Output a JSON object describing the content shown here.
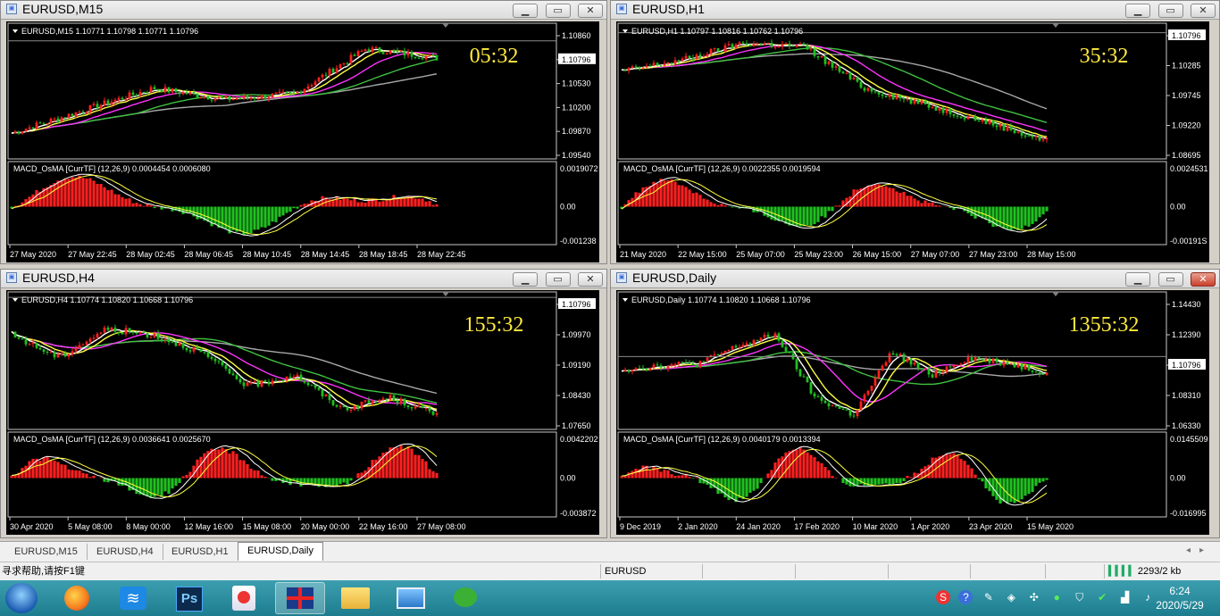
{
  "windows": [
    {
      "id": "m15",
      "title": "EURUSD,M15",
      "header": "EURUSD,M15  1.10771 1.10798 1.10771 1.10796",
      "countdown": "05:32",
      "price_scale": [
        "1.10860",
        "1.10796",
        "1.10530",
        "1.10200",
        "1.09870",
        "1.09540"
      ],
      "price_level": 0.87,
      "indicator_header": "MACD_OsMA [CurrTF] (12,26,9) 0.0004454 0.0006080",
      "indicator_scale": [
        "0.0019072",
        "0.00",
        "-0.001238"
      ],
      "time_labels": [
        "27 May 2020",
        "27 May 22:45",
        "28 May 02:45",
        "28 May 06:45",
        "28 May 10:45",
        "28 May 14:45",
        "28 May 18:45",
        "28 May 22:45"
      ],
      "close_red": false
    },
    {
      "id": "h1",
      "title": "EURUSD,H1",
      "header": "EURUSD,H1  1.10797 1.10816 1.10762 1.10796",
      "countdown": "35:32",
      "price_scale": [
        "1.10796",
        "1.10285",
        "1.09745",
        "1.09220",
        "1.08695"
      ],
      "price_level": 0.93,
      "indicator_header": "MACD_OsMA [CurrTF] (12,26,9) 0.0022355 0.0019594",
      "indicator_scale": [
        "0.0024531",
        "0.00",
        "-0.00191S"
      ],
      "time_labels": [
        "21 May 2020",
        "22 May 15:00",
        "25 May 07:00",
        "25 May 23:00",
        "26 May 15:00",
        "27 May 07:00",
        "27 May 23:00",
        "28 May 15:00"
      ],
      "close_red": false
    },
    {
      "id": "h4",
      "title": "EURUSD,H4",
      "header": "EURUSD,H4  1.10774 1.10820 1.10668 1.10796",
      "countdown": "155:32",
      "price_scale": [
        "1.10796",
        "1.09970",
        "1.09190",
        "1.08430",
        "1.07650"
      ],
      "price_level": 0.96,
      "indicator_header": "MACD_OsMA [CurrTF] (12,26,9) 0.0036641 0.0025670",
      "indicator_scale": [
        "0.0042202",
        "0.00",
        "-0.003872"
      ],
      "time_labels": [
        "30 Apr 2020",
        "5 May 08:00",
        "8 May 00:00",
        "12 May 16:00",
        "15 May 08:00",
        "20 May 00:00",
        "22 May 16:00",
        "27 May 08:00"
      ],
      "close_red": false
    },
    {
      "id": "daily",
      "title": "EURUSD,Daily",
      "header": "EURUSD,Daily  1.10774 1.10820 1.10668 1.10796",
      "countdown": "1355:32",
      "price_scale": [
        "1.14430",
        "1.12390",
        "1.10796",
        "1.08310",
        "1.06330"
      ],
      "price_level": 0.53,
      "indicator_header": "MACD_OsMA [CurrTF] (12,26,9) 0.0040179 0.0013394",
      "indicator_scale": [
        "0.0145509",
        "0.00",
        "-0.016995"
      ],
      "time_labels": [
        "9 Dec 2019",
        "2 Jan 2020",
        "24 Jan 2020",
        "17 Feb 2020",
        "10 Mar 2020",
        "1 Apr 2020",
        "23 Apr 2020",
        "15 May 2020"
      ],
      "close_red": true
    }
  ],
  "tabs": [
    "EURUSD,M15",
    "EURUSD,H4",
    "EURUSD,H1",
    "EURUSD,Daily"
  ],
  "active_tab": "EURUSD,Daily",
  "status": {
    "help": "寻求帮助,请按F1键",
    "profile": "EURUSD",
    "traffic": "2293/2 kb"
  },
  "taskbar": {
    "apps": [
      "start-orb",
      "firefox-icon",
      "mindmap-app-icon",
      "photoshop-icon",
      "paint-icon",
      "metatrader-icon",
      "folder-icon",
      "photo-viewer-icon",
      "wechat-icon"
    ],
    "photoshop_label": "Ps",
    "time": "6:24",
    "date": "2020/5/29"
  },
  "colors": {
    "chart_bg": "#000000",
    "bull": "#ff2020",
    "bear": "#20c020",
    "ma_white": "#ffffff",
    "ma_yellow": "#ffff40",
    "ma_magenta": "#ff33ff",
    "ma_green": "#40c040",
    "ma_gray": "#a8a8a8",
    "countdown": "#ffea3c",
    "text": "#ffffff"
  }
}
